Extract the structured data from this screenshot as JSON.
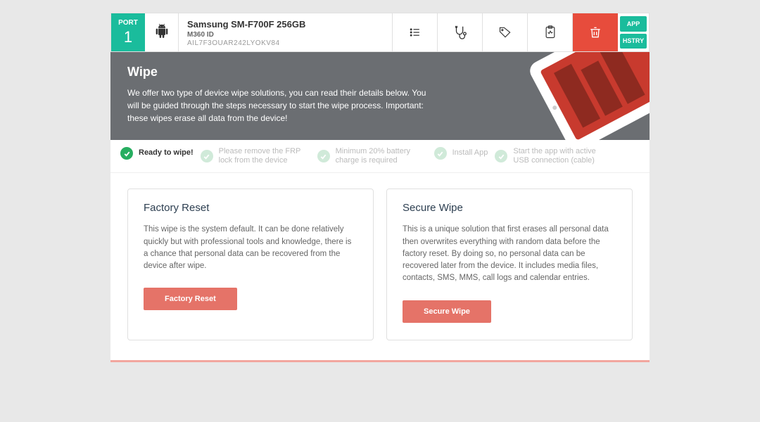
{
  "port": {
    "label": "PORT",
    "number": "1"
  },
  "device": {
    "name": "Samsung SM-F700F 256GB",
    "sub": "M360 ID",
    "id": "AIL7F3OUAR242LYOKV84"
  },
  "sideButtons": {
    "app": "APP",
    "history": "HSTRY"
  },
  "banner": {
    "title": "Wipe",
    "body": "We offer two type of device wipe solutions, you can read their details below. You will be guided through the steps necessary to start the wipe process. Important: these wipes erase all data from the device!"
  },
  "status": {
    "ready": "Ready to wipe!",
    "frp": "Please remove the FRP lock from the device",
    "battery": "Minimum 20% battery charge is required",
    "install": "Install App",
    "usb": "Start the app with active USB connection (cable)"
  },
  "cards": {
    "factory": {
      "title": "Factory Reset",
      "body": "This wipe is the system default. It can be done relatively quickly but with professional tools and knowledge, there is a chance that personal data can be recovered from the device after wipe.",
      "button": "Factory Reset"
    },
    "secure": {
      "title": "Secure Wipe",
      "body": "This is a unique solution that first erases all personal data then overwrites everything with random data before the factory reset. By doing so, no personal data can be recovered later from the device. It includes media files, contacts, SMS, MMS, call logs and calendar entries.",
      "button": "Secure Wipe"
    }
  }
}
